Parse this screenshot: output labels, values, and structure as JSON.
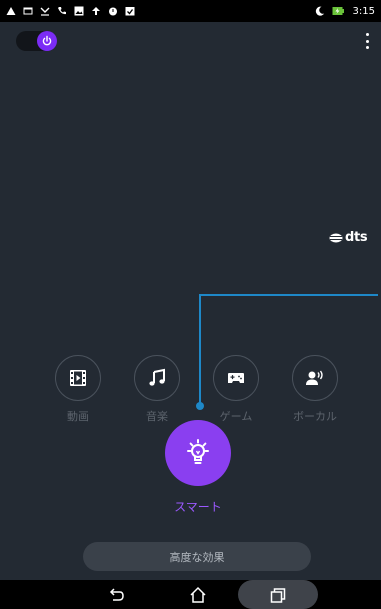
{
  "status_bar": {
    "left_icons": [
      "alert-icon",
      "image-icon",
      "missed-call-icon",
      "phone-icon",
      "gallery-icon",
      "sync-icon",
      "alarm-icon",
      "checkbox-icon"
    ],
    "right_icons": [
      "moon-icon",
      "battery-icon"
    ],
    "time": "3:15",
    "battery_color": "#6ac33a"
  },
  "header": {
    "power_toggle": {
      "state": "on",
      "icon": "power-icon",
      "color": "#7b2cf5"
    },
    "menu_icon": "more-vert-icon"
  },
  "brand": {
    "logo_text": "dts"
  },
  "modes": [
    {
      "id": "movie",
      "icon": "film-icon",
      "label": "動画"
    },
    {
      "id": "music",
      "icon": "music-note-icon",
      "label": "音楽"
    },
    {
      "id": "game",
      "icon": "gamepad-icon",
      "label": "ゲーム"
    },
    {
      "id": "vocal",
      "icon": "voice-icon",
      "label": "ボーカル"
    }
  ],
  "smart_mode": {
    "icon": "lightbulb-icon",
    "label": "スマート",
    "color": "#8a3ff0",
    "selected": true
  },
  "advanced_button": {
    "label": "高度な効果"
  },
  "nav_bar": {
    "buttons": [
      "back-icon",
      "home-icon",
      "recents-icon"
    ]
  },
  "colors": {
    "background": "#232a33",
    "accent": "#8a3ff0",
    "connector": "#1e88c8"
  }
}
